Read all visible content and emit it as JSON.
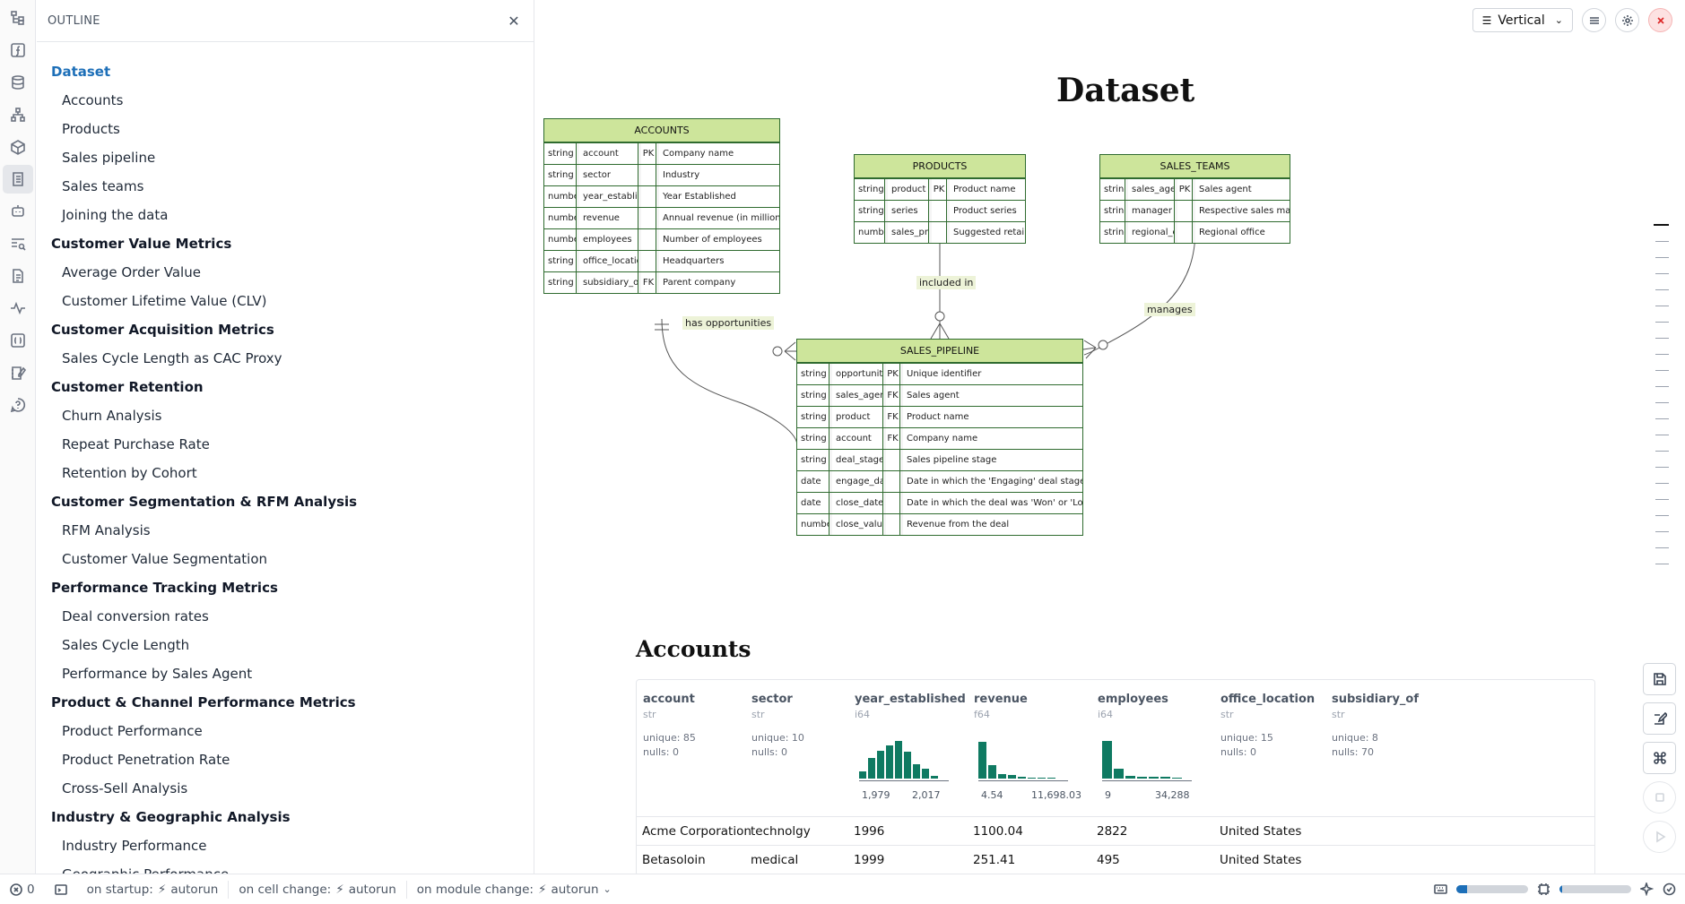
{
  "outline": {
    "title": "OUTLINE",
    "items": [
      {
        "label": "Dataset",
        "level": 1,
        "active": true
      },
      {
        "label": "Accounts",
        "level": 2
      },
      {
        "label": "Products",
        "level": 2
      },
      {
        "label": "Sales pipeline",
        "level": 2
      },
      {
        "label": "Sales teams",
        "level": 2
      },
      {
        "label": "Joining the data",
        "level": 2
      },
      {
        "label": "Customer Value Metrics",
        "level": 1
      },
      {
        "label": "Average Order Value",
        "level": 2
      },
      {
        "label": "Customer Lifetime Value (CLV)",
        "level": 2
      },
      {
        "label": "Customer Acquisition Metrics",
        "level": 1
      },
      {
        "label": "Sales Cycle Length as CAC Proxy",
        "level": 2
      },
      {
        "label": "Customer Retention",
        "level": 1
      },
      {
        "label": "Churn Analysis",
        "level": 2
      },
      {
        "label": "Repeat Purchase Rate",
        "level": 2
      },
      {
        "label": "Retention by Cohort",
        "level": 2
      },
      {
        "label": "Customer Segmentation & RFM Analysis",
        "level": 1
      },
      {
        "label": "RFM Analysis",
        "level": 2
      },
      {
        "label": "Customer Value Segmentation",
        "level": 2
      },
      {
        "label": "Performance Tracking Metrics",
        "level": 1
      },
      {
        "label": "Deal conversion rates",
        "level": 2
      },
      {
        "label": "Sales Cycle Length",
        "level": 2
      },
      {
        "label": "Performance by Sales Agent",
        "level": 2
      },
      {
        "label": "Product & Channel Performance Metrics",
        "level": 1
      },
      {
        "label": "Product Performance",
        "level": 2
      },
      {
        "label": "Product Penetration Rate",
        "level": 2
      },
      {
        "label": "Cross-Sell Analysis",
        "level": 2
      },
      {
        "label": "Industry & Geographic Analysis",
        "level": 1
      },
      {
        "label": "Industry Performance",
        "level": 2
      },
      {
        "label": "Geographic Performance",
        "level": 2
      }
    ]
  },
  "toolbar": {
    "layout_label": "Vertical"
  },
  "page": {
    "title": "Dataset",
    "section_title": "Accounts"
  },
  "er": {
    "tables": [
      {
        "id": "accounts",
        "name": "ACCOUNTS",
        "rows": [
          [
            "string",
            "account",
            "PK",
            "Company name"
          ],
          [
            "string",
            "sector",
            "",
            "Industry"
          ],
          [
            "number",
            "year_established",
            "",
            "Year Established"
          ],
          [
            "number",
            "revenue",
            "",
            "Annual revenue (in millions of USD)"
          ],
          [
            "number",
            "employees",
            "",
            "Number of employees"
          ],
          [
            "string",
            "office_location",
            "",
            "Headquarters"
          ],
          [
            "string",
            "subsidiary_of",
            "FK",
            "Parent company"
          ]
        ]
      },
      {
        "id": "products",
        "name": "PRODUCTS",
        "rows": [
          [
            "string",
            "product",
            "PK",
            "Product name"
          ],
          [
            "string",
            "series",
            "",
            "Product series"
          ],
          [
            "number",
            "sales_price",
            "",
            "Suggested retail price"
          ]
        ]
      },
      {
        "id": "sales_teams",
        "name": "SALES_TEAMS",
        "rows": [
          [
            "string",
            "sales_agent",
            "PK",
            "Sales agent"
          ],
          [
            "string",
            "manager",
            "",
            "Respective sales manager"
          ],
          [
            "string",
            "regional_office",
            "",
            "Regional office"
          ]
        ]
      },
      {
        "id": "sales_pipeline",
        "name": "SALES_PIPELINE",
        "rows": [
          [
            "string",
            "opportunity_id",
            "PK",
            "Unique identifier"
          ],
          [
            "string",
            "sales_agent",
            "FK",
            "Sales agent"
          ],
          [
            "string",
            "product",
            "FK",
            "Product name"
          ],
          [
            "string",
            "account",
            "FK",
            "Company name"
          ],
          [
            "string",
            "deal_stage",
            "",
            "Sales pipeline stage"
          ],
          [
            "date",
            "engage_date",
            "",
            "Date in which the 'Engaging' deal stage was initiated"
          ],
          [
            "date",
            "close_date",
            "",
            "Date in which the deal was 'Won' or 'Lost'"
          ],
          [
            "number",
            "close_value",
            "",
            "Revenue from the deal"
          ]
        ]
      }
    ],
    "relations": [
      "has opportunities",
      "included in",
      "manages"
    ]
  },
  "columns": [
    {
      "name": "account",
      "type": "str",
      "stats": [
        "unique: 85",
        "nulls: 0"
      ]
    },
    {
      "name": "sector",
      "type": "str",
      "stats": [
        "unique: 10",
        "nulls: 0"
      ]
    },
    {
      "name": "year_established",
      "type": "i64",
      "hist": [
        0.15,
        0.45,
        0.6,
        0.72,
        0.8,
        0.58,
        0.3,
        0.22,
        0.05
      ],
      "min": "1,979",
      "max": "2,017"
    },
    {
      "name": "revenue",
      "type": "f64",
      "hist": [
        0.78,
        0.28,
        0.1,
        0.07,
        0.03,
        0.02,
        0.02,
        0.01
      ],
      "min": "4.54",
      "max": "11,698.03"
    },
    {
      "name": "employees",
      "type": "i64",
      "hist": [
        0.8,
        0.22,
        0.05,
        0.04,
        0.03,
        0.03,
        0.02
      ],
      "min": "9",
      "max": "34,288"
    },
    {
      "name": "office_location",
      "type": "str",
      "stats": [
        "unique: 15",
        "nulls: 0"
      ]
    },
    {
      "name": "subsidiary_of",
      "type": "str",
      "stats": [
        "unique: 8",
        "nulls: 70"
      ]
    }
  ],
  "rows": [
    [
      "Acme Corporation",
      "technolgy",
      "1996",
      "1100.04",
      "2822",
      "United States",
      ""
    ],
    [
      "Betasoloin",
      "medical",
      "1999",
      "251.41",
      "495",
      "United States",
      ""
    ]
  ],
  "statusbar": {
    "errors": "0",
    "startup": "on startup:",
    "startup_val": "autorun",
    "cell_change": "on cell change:",
    "cell_change_val": "autorun",
    "module_change": "on module change:",
    "module_change_val": "autorun",
    "progress_1": 0.15,
    "progress_2": 0.04
  }
}
